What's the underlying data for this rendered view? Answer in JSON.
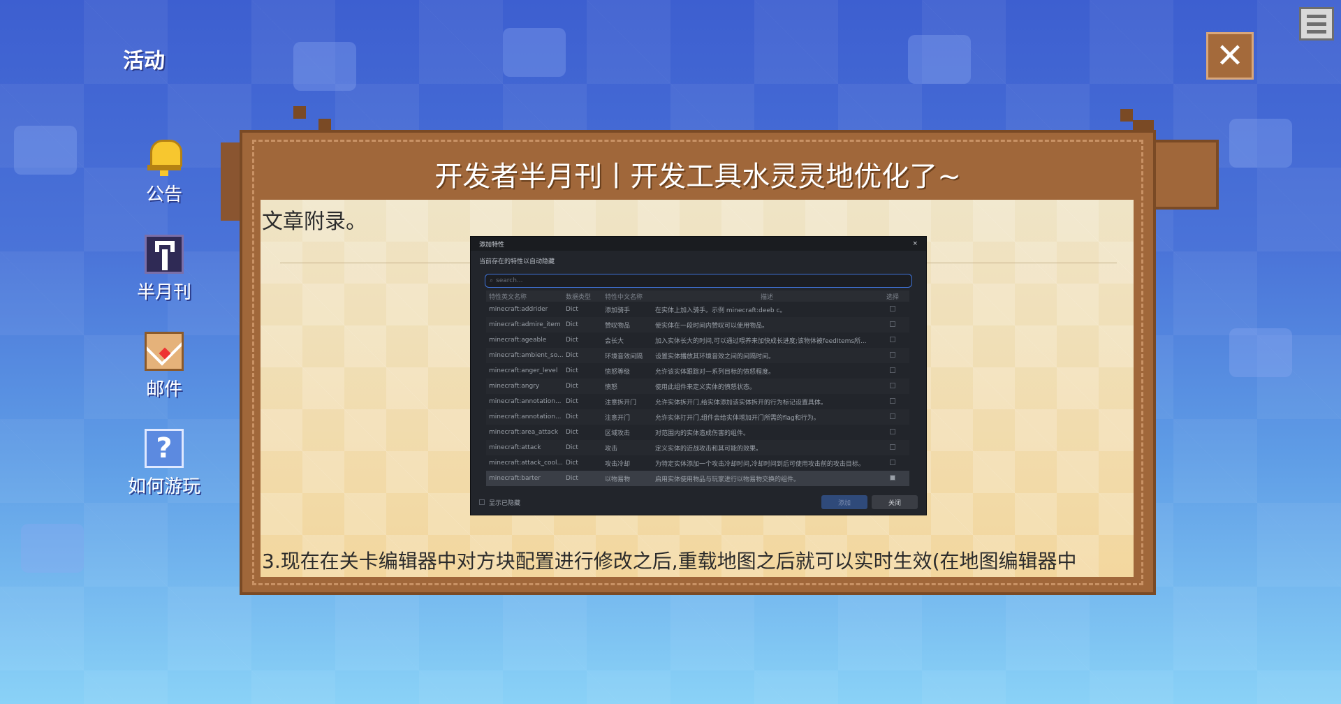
{
  "sidebar": {
    "title": "活动",
    "items": [
      {
        "label": "公告",
        "icon": "bell-icon"
      },
      {
        "label": "半月刊",
        "icon": "wrench-icon"
      },
      {
        "label": "邮件",
        "icon": "mail-icon"
      },
      {
        "label": "如何游玩",
        "icon": "help-icon"
      }
    ]
  },
  "top_right": {
    "menu_icon": "list-icon",
    "close_glyph": "✕"
  },
  "panel": {
    "title": "开发者半月刊丨开发工具水灵灵地优化了~",
    "article_heading": "文章附录。",
    "article_bottom_text": "3.现在在关卡编辑器中对方块配置进行修改之后,重载地图之后就可以实时生效(在地图编辑器中"
  },
  "dialog": {
    "title": "添加特性",
    "close_glyph": "×",
    "subtitle": "当前存在的特性以自动隐藏",
    "search_placeholder": "search...",
    "columns": [
      "特性英文名称",
      "数据类型",
      "特性中文名称",
      "描述",
      "选择"
    ],
    "rows": [
      {
        "en": "minecraft:addrider",
        "type": "Dict",
        "cn": "添加骑手",
        "desc": "在实体上加入骑手。示例 minecraft:deeb c。",
        "checked": false
      },
      {
        "en": "minecraft:admire_item",
        "type": "Dict",
        "cn": "赞叹物品",
        "desc": "使实体在一段时间内赞叹可以使用物品。",
        "checked": false
      },
      {
        "en": "minecraft:ageable",
        "type": "Dict",
        "cn": "会长大",
        "desc": "加入实体长大的时间,可以通过喂养来加快成长进度;该物体被feedItems所...",
        "checked": false
      },
      {
        "en": "minecraft:ambient_so...",
        "type": "Dict",
        "cn": "环境音效间隔",
        "desc": "设置实体播放其环境音效之间的间隔时间。",
        "checked": false
      },
      {
        "en": "minecraft:anger_level",
        "type": "Dict",
        "cn": "愤怒等级",
        "desc": "允许该实体跟踪对一系列目标的愤怒程度。",
        "checked": false
      },
      {
        "en": "minecraft:angry",
        "type": "Dict",
        "cn": "愤怒",
        "desc": "使用此组件来定义实体的愤怒状态。",
        "checked": false
      },
      {
        "en": "minecraft:annotation...",
        "type": "Dict",
        "cn": "注意拆开门",
        "desc": "允许实体拆开门,给实体添加该实体拆开的行为标记设置具体。",
        "checked": false
      },
      {
        "en": "minecraft:annotation...",
        "type": "Dict",
        "cn": "注意开门",
        "desc": "允许实体打开门,组件会给实体增加开门所需的flag和行为。",
        "checked": false
      },
      {
        "en": "minecraft:area_attack",
        "type": "Dict",
        "cn": "区域攻击",
        "desc": "对范围内的实体造成伤害的组件。",
        "checked": false
      },
      {
        "en": "minecraft:attack",
        "type": "Dict",
        "cn": "攻击",
        "desc": "定义实体的近战攻击和其可能的效果。",
        "checked": false
      },
      {
        "en": "minecraft:attack_cool...",
        "type": "Dict",
        "cn": "攻击冷却",
        "desc": "为特定实体添加一个攻击冷却时间,冷却时间到后可使用攻击前的攻击目标。",
        "checked": false
      },
      {
        "en": "minecraft:barter",
        "type": "Dict",
        "cn": "以物易物",
        "desc": "启用实体使用物品与玩家进行以物易物交换的组件。",
        "checked": true
      }
    ],
    "footer_checkbox_label": "显示已隐藏",
    "confirm_label": "添加",
    "cancel_label": "关闭"
  }
}
